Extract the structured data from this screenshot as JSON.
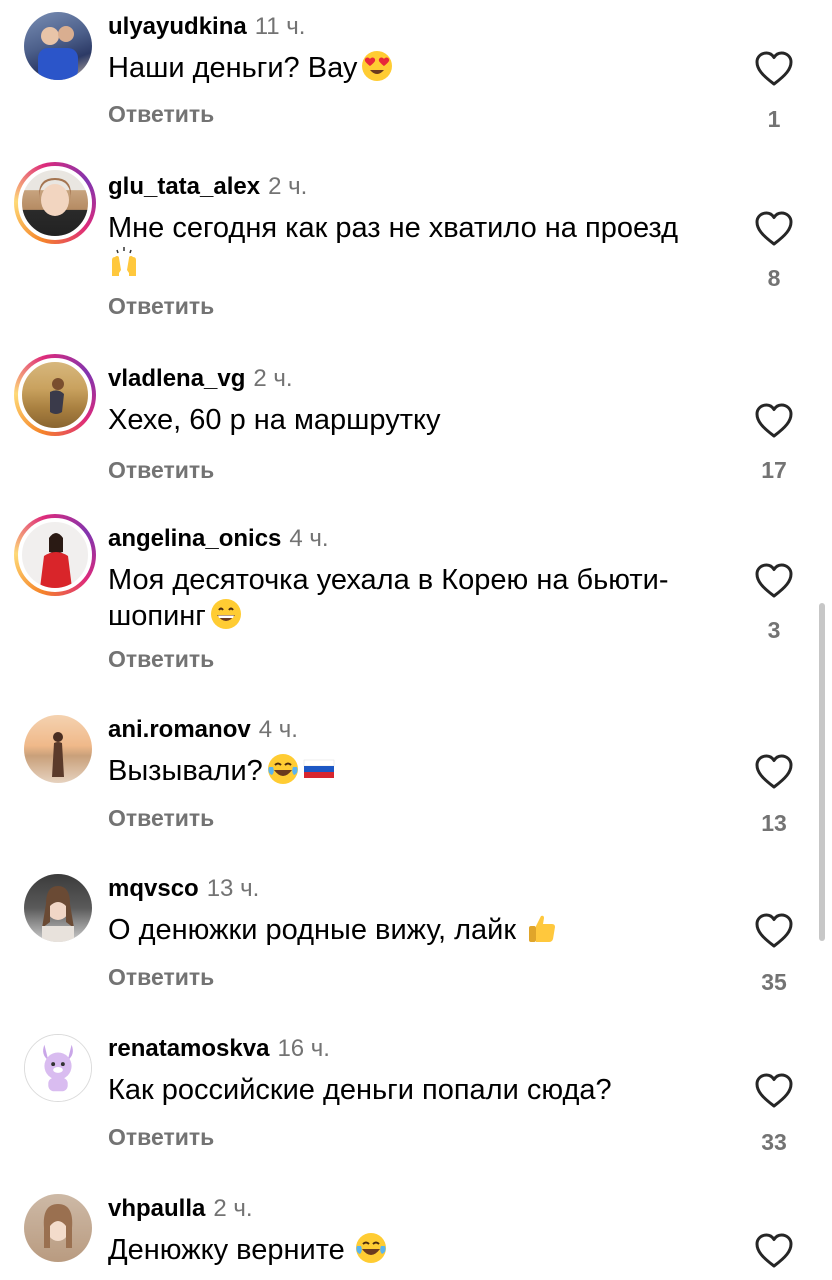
{
  "comments": [
    {
      "username": "ulyayudkina",
      "time": "11 ч.",
      "text": "Наши деньги? Вау",
      "emojis": [
        "heart-eyes-emoji"
      ],
      "reply_label": "Ответить",
      "like_count": "1",
      "has_story": false
    },
    {
      "username": "glu_tata_alex",
      "time": "2 ч.",
      "text": "Мне сегодня как раз не хватило на проезд",
      "emojis": [
        "raising-hands-emoji"
      ],
      "reply_label": "Ответить",
      "like_count": "8",
      "has_story": true
    },
    {
      "username": "vladlena_vg",
      "time": "2 ч.",
      "text": "Хехе, 60 р на маршрутку",
      "emojis": [],
      "reply_label": "Ответить",
      "like_count": "17",
      "has_story": true
    },
    {
      "username": "angelina_onics",
      "time": "4 ч.",
      "text": "Моя десяточка  уехала в Корею на бьюти-шопинг",
      "emojis": [
        "grinning-face-emoji"
      ],
      "reply_label": "Ответить",
      "like_count": "3",
      "has_story": true
    },
    {
      "username": "ani.romanov",
      "time": "4 ч.",
      "text": "Вызывали?",
      "emojis": [
        "tears-of-joy-emoji",
        "russia-flag-emoji"
      ],
      "reply_label": "Ответить",
      "like_count": "13",
      "has_story": false
    },
    {
      "username": "mqvsco",
      "time": "13 ч.",
      "text": "О денюжки родные вижу, лайк",
      "emojis": [
        "thumbs-up-emoji"
      ],
      "reply_label": "Ответить",
      "like_count": "35",
      "has_story": false
    },
    {
      "username": "renatamoskva",
      "time": "16 ч.",
      "text": "Как российские деньги попали сюда?",
      "emojis": [],
      "reply_label": "Ответить",
      "like_count": "33",
      "has_story": false
    },
    {
      "username": "vhpaulla",
      "time": "2 ч.",
      "text": "Денюжку верните",
      "emojis": [
        "tears-of-joy-emoji"
      ],
      "reply_label": "",
      "like_count": "",
      "has_story": false
    }
  ],
  "colors": {
    "text": "#000000",
    "secondary": "#737373",
    "background": "#ffffff"
  }
}
